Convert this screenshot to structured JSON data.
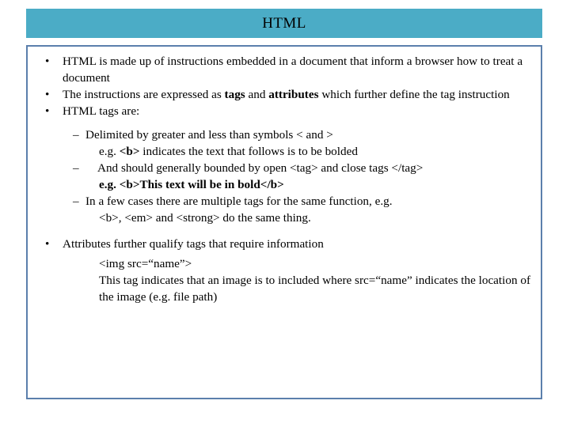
{
  "slide": {
    "title": "HTML",
    "colors": {
      "title_bar": "#4BACC6",
      "body_border": "#5B7FAC",
      "background": "#FFFFFF",
      "text": "#000000"
    },
    "bullets": {
      "b1_marker": "•",
      "b2_marker": "–"
    },
    "content": [
      {
        "level": 1,
        "text": "HTML is made up of instructions embedded in a document that inform a browser how to treat a document"
      },
      {
        "level": 1,
        "text_before": "The instructions are expressed as ",
        "bold1": "tags",
        "text_mid": " and ",
        "bold2": "attributes",
        "text_after": " which further define the tag instruction"
      },
      {
        "level": 1,
        "text": "HTML tags are:"
      },
      {
        "level": 2,
        "text": "Delimited by greater and less than symbols  < and >"
      },
      {
        "level": 3,
        "text_before": "e.g. ",
        "bold": "<b>",
        "text_after": " indicates the text that follows is to be bolded"
      },
      {
        "level": 2,
        "wide": true,
        "text": "And should generally bounded by open <tag> and close tags </tag>"
      },
      {
        "level": 3,
        "bold_all": true,
        "text": "e.g. <b>This  text will be in bold</b>"
      },
      {
        "level": 2,
        "text": "In a few cases there are multiple tags for the same function, e.g."
      },
      {
        "level": 3,
        "text": "<b>, <em>  and <strong> do the same thing."
      },
      {
        "level": 1,
        "text": "Attributes further qualify tags that require information"
      },
      {
        "level": 3,
        "text": "<img src=“name”>"
      },
      {
        "level": 3,
        "text": "This tag indicates that an image is to included where src=“name” indicates the location of the image (e.g. file path)"
      }
    ]
  }
}
